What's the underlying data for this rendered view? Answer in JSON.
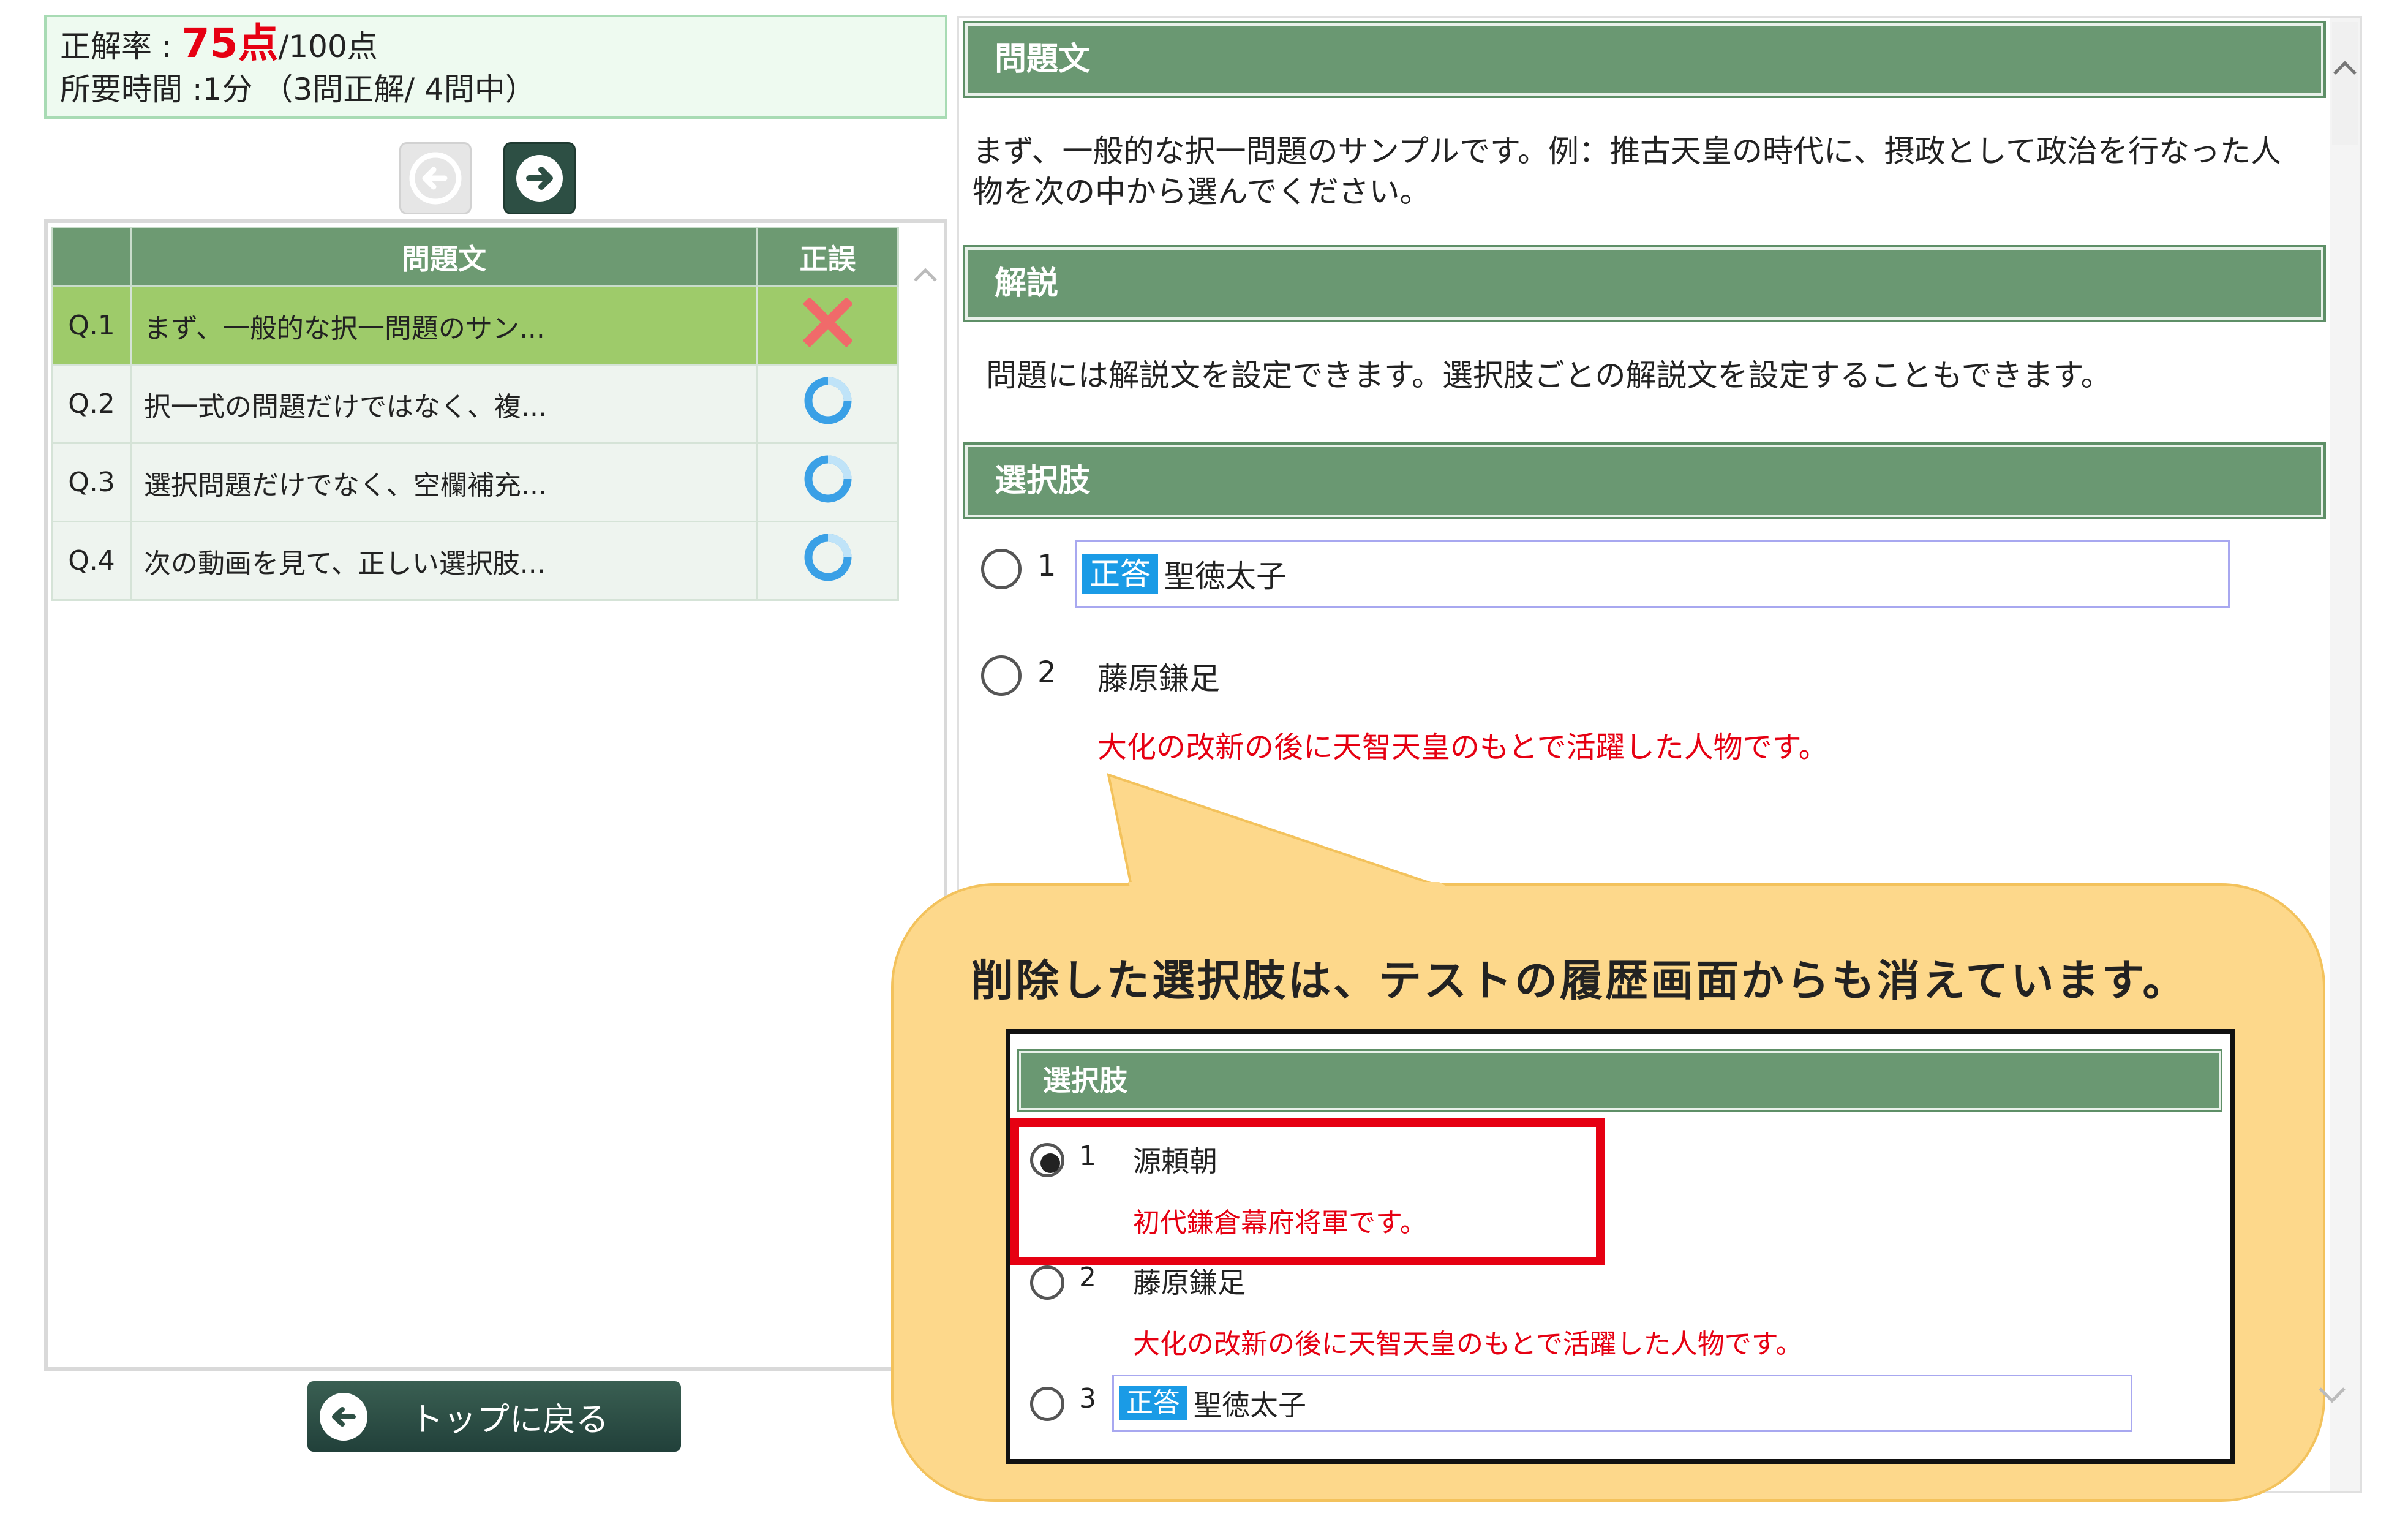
{
  "score": {
    "rate_label": "正解率 : ",
    "rate_value": "75点",
    "rate_total": "/100点",
    "time_line": "所要時間 :1分 （3問正解/ 4問中）"
  },
  "nav": {
    "prev_icon": "arrow-left-icon",
    "next_icon": "arrow-right-icon"
  },
  "question_list": {
    "headers": [
      "",
      "問題文",
      "正誤"
    ],
    "rows": [
      {
        "num": "Q.1",
        "text": "まず、一般的な択一問題のサン...",
        "result": "wrong"
      },
      {
        "num": "Q.2",
        "text": "択一式の問題だけではなく、複...",
        "result": "correct"
      },
      {
        "num": "Q.3",
        "text": "選択問題だけでなく、空欄補充...",
        "result": "correct"
      },
      {
        "num": "Q.4",
        "text": "次の動画を見て、正しい選択肢...",
        "result": "correct"
      }
    ]
  },
  "back_button": {
    "label": "トップに戻る"
  },
  "detail": {
    "question_header": "問題文",
    "question_text_1": "まず、一般的な択一問題のサンプルです。例：推古天皇の時代に、摂政として政治を行なった人",
    "question_text_2": "物を次の中から選んでください。",
    "explanation_header": "解説",
    "explanation_text": "問題には解説文を設定できます。選択肢ごとの解説文を設定することもできます。",
    "choices_header": "選択肢",
    "choices": [
      {
        "num": "1",
        "tag": "正答",
        "text": "聖徳太子",
        "explanation": ""
      },
      {
        "num": "2",
        "tag": "",
        "text": "藤原鎌足",
        "explanation": "大化の改新の後に天智天皇のもとで活躍した人物です。"
      }
    ]
  },
  "callout": {
    "title": "削除した選択肢は、テストの履歴画面からも消えています。",
    "inner_header": "選択肢",
    "choices": [
      {
        "num": "1",
        "text": "源頼朝",
        "explanation": "初代鎌倉幕府将軍です。",
        "selected": true
      },
      {
        "num": "2",
        "text": "藤原鎌足",
        "explanation": "大化の改新の後に天智天皇のもとで活躍した人物です。",
        "selected": false
      },
      {
        "num": "3",
        "tag": "正答",
        "text": "聖徳太子",
        "selected": false
      }
    ]
  },
  "colors": {
    "header_green": "#6a9872",
    "selected_row": "#9ecb6a",
    "score_red": "#e60012",
    "tag_blue": "#1a9be6",
    "callout_yellow": "#fdd88b"
  }
}
